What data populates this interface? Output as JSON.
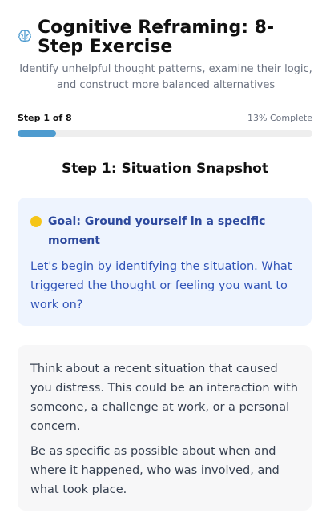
{
  "header": {
    "title": "Cognitive Reframing: 8-Step Exercise",
    "subtitle": "Identify unhelpful thought patterns, examine their logic, and construct more balanced alternatives",
    "icon": "brain-icon"
  },
  "progress": {
    "step_label": "Step 1 of 8",
    "percent_label": "13% Complete",
    "fraction": 0.13,
    "color": "#4e9bcf"
  },
  "step": {
    "title": "Step 1: Situation Snapshot"
  },
  "goal": {
    "icon": "yellow-circle-icon",
    "heading": "Goal: Ground yourself in a specific moment",
    "body": "Let's begin by identifying the situation. What triggered the thought or feeling you want to work on?"
  },
  "info": {
    "paragraph1": "Think about a recent situation that caused you distress. This could be an interaction with someone, a challenge at work, or a personal concern.",
    "paragraph2": "Be as specific as possible about when and where it happened, who was involved, and what took place."
  }
}
